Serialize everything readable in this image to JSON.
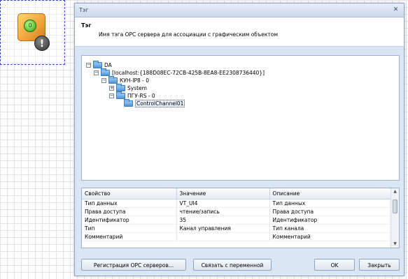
{
  "canvas": {
    "badge_glyph": "!",
    "knob_label": "0"
  },
  "dialog": {
    "title": "Тэг",
    "close_glyph": "✕",
    "header_title": "Тэг",
    "header_desc": "Имя тэга OPC сервера для ассоциации с графическим объектом"
  },
  "tree": [
    {
      "label": "DA",
      "toggle": "−"
    },
    {
      "label": "[localhost:{188D08EC-72CB-425B-8EA8-EE2308736440}]",
      "toggle": "−"
    },
    {
      "label": "КУН-IP8 - 0",
      "toggle": "−"
    },
    {
      "label": "System",
      "toggle": "+"
    },
    {
      "label": "ПГУ-RS - 0",
      "toggle": "−"
    },
    {
      "label": "ControlChannel01",
      "toggle": ""
    }
  ],
  "props": {
    "headers": [
      "Свойство",
      "Значение",
      "Описание"
    ],
    "rows": [
      [
        "Тип данных",
        "VT_UI4",
        "Тип данных"
      ],
      [
        "Права доступа",
        "чтение/запись",
        "Права доступа"
      ],
      [
        "Идентификатор",
        "35",
        "Идентификатор"
      ],
      [
        "Тип",
        "Канал управления",
        "Тип канала"
      ],
      [
        "Комментарий",
        "",
        "Комментарий"
      ]
    ],
    "scroll_up": "▲",
    "scroll_down": "▼"
  },
  "buttons": {
    "register": "Регистрация OPC серверов...",
    "bind": "Связать с переменной",
    "ok": "OK",
    "close": "Закрыть"
  }
}
